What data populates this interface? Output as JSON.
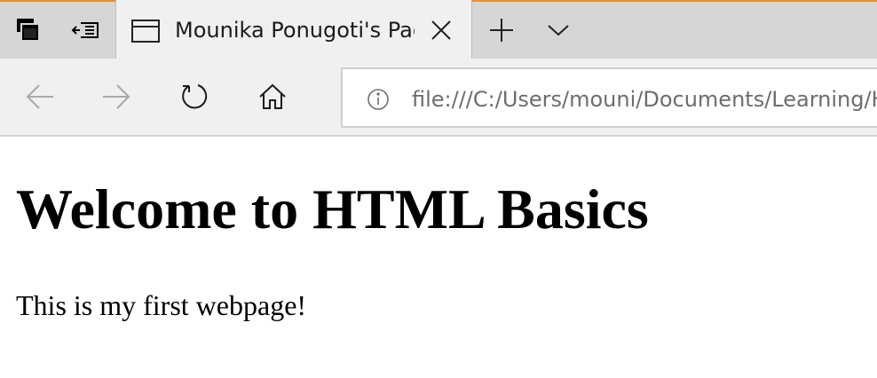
{
  "colors": {
    "accent_border": "#e8902e",
    "tabstrip_bg": "#d6d6d6",
    "toolbar_bg": "#f0f0f0",
    "url_text": "#6d6d6d",
    "page_bg": "#ffffff"
  },
  "tabstrip": {
    "left_buttons": [
      {
        "name": "tabs-overview-icon"
      },
      {
        "name": "set-tabs-aside-icon"
      }
    ],
    "active_tab": {
      "title": "Mounika Ponugoti's Page",
      "icon": "page-icon",
      "close_icon": "close-icon"
    },
    "new_tab_icon": "plus-icon",
    "tab_preview_icon": "chevron-down-icon"
  },
  "navbar": {
    "back_icon": "back-arrow-icon",
    "forward_icon": "forward-arrow-icon",
    "refresh_icon": "refresh-icon",
    "home_icon": "home-icon",
    "address": {
      "info_icon": "info-icon",
      "url": "file:///C:/Users/mouni/Documents/Learning/HTML/index.html"
    }
  },
  "page": {
    "heading": "Welcome to HTML Basics",
    "paragraph": "This is my first webpage!"
  }
}
